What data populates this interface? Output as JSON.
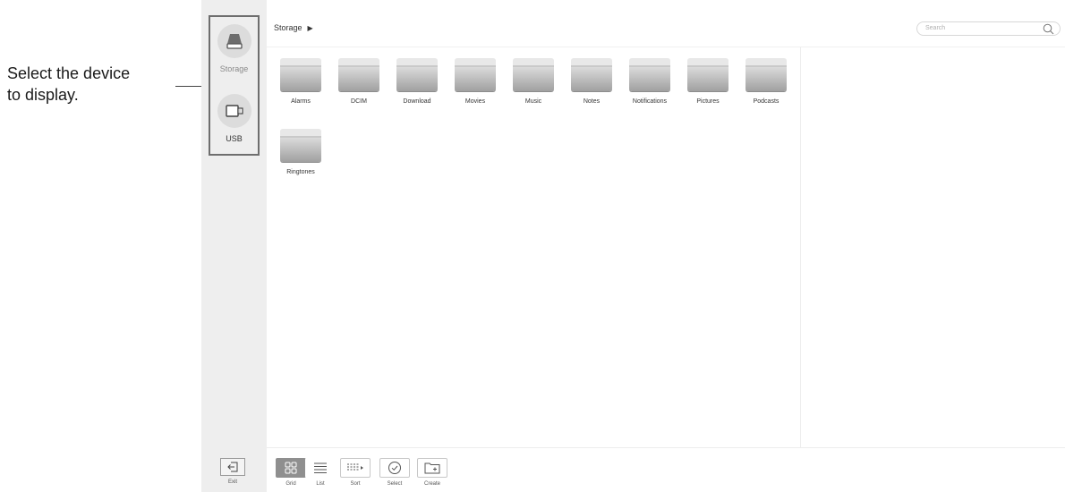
{
  "callout": {
    "text_line1": "Select the device",
    "text_line2": "to display."
  },
  "devices": [
    {
      "label": "Storage",
      "icon": "drive-icon",
      "selected": true
    },
    {
      "label": "USB",
      "icon": "usb-icon",
      "selected": false
    }
  ],
  "exit": {
    "label": "Exit"
  },
  "breadcrumb": {
    "current": "Storage"
  },
  "search": {
    "placeholder": "Search"
  },
  "folders": [
    {
      "name": "Alarms"
    },
    {
      "name": "DCIM"
    },
    {
      "name": "Download"
    },
    {
      "name": "Movies"
    },
    {
      "name": "Music"
    },
    {
      "name": "Notes"
    },
    {
      "name": "Notifications"
    },
    {
      "name": "Pictures"
    },
    {
      "name": "Podcasts"
    },
    {
      "name": "Ringtones"
    }
  ],
  "toolbar": {
    "grid": "Grid",
    "list": "List",
    "sort": "Sort",
    "select": "Select",
    "create": "Create"
  },
  "colors": {
    "sidebar": "#eeeeee",
    "active_tool": "#8f8f8f"
  }
}
